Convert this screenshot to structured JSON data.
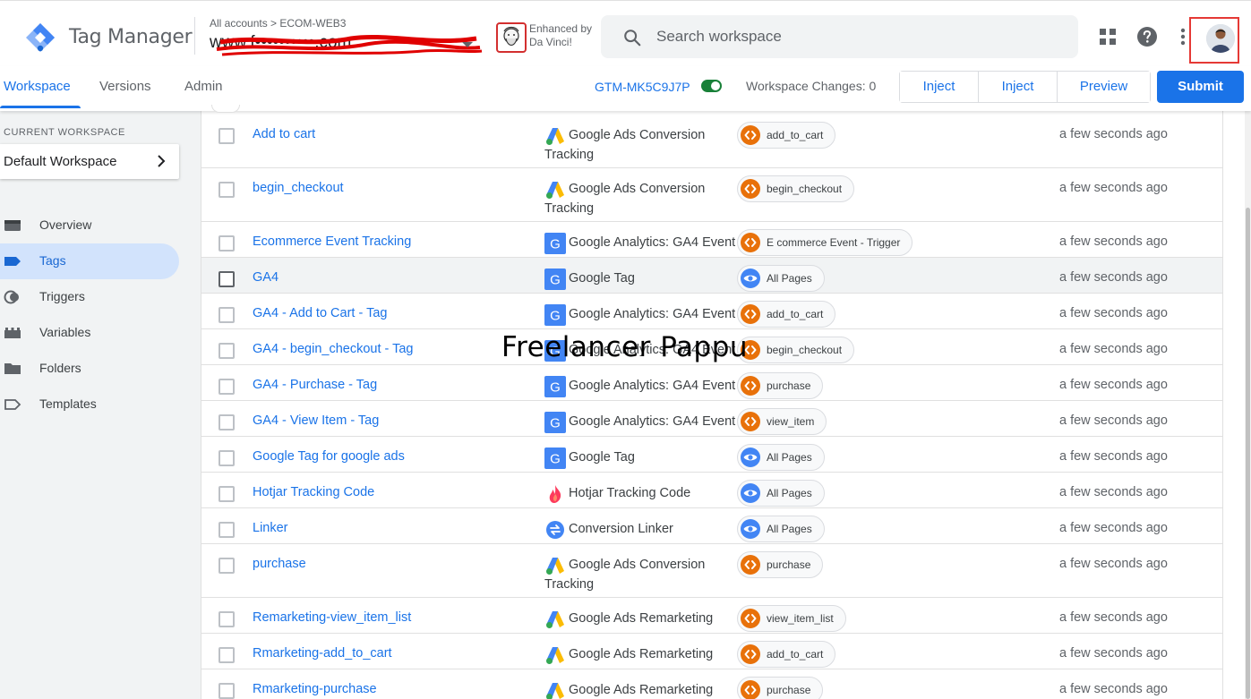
{
  "header": {
    "app_title": "Tag Manager",
    "breadcrumb": "All accounts > ECOM-WEB3",
    "container_name": "www.f••••••••••.com",
    "extension_text_line1": "Enhanced by",
    "extension_text_line2": "Da Vinci!",
    "search_placeholder": "Search workspace"
  },
  "nav": {
    "tabs": [
      {
        "label": "Workspace",
        "active": true
      },
      {
        "label": "Versions",
        "active": false
      },
      {
        "label": "Admin",
        "active": false
      }
    ],
    "container_id": "GTM-MK5C9J7P",
    "workspace_changes": "Workspace Changes: 0",
    "inject1_label": "Inject",
    "inject2_label": "Inject",
    "preview_label": "Preview",
    "submit_label": "Submit"
  },
  "sidebar": {
    "current_workspace_label": "CURRENT WORKSPACE",
    "workspace_name": "Default Workspace",
    "items": [
      {
        "label": "Overview",
        "icon": "overview-icon",
        "active": false
      },
      {
        "label": "Tags",
        "icon": "tag-icon",
        "active": true
      },
      {
        "label": "Triggers",
        "icon": "trigger-icon",
        "active": false
      },
      {
        "label": "Variables",
        "icon": "variables-icon",
        "active": false
      },
      {
        "label": "Folders",
        "icon": "folder-icon",
        "active": false
      },
      {
        "label": "Templates",
        "icon": "template-icon",
        "active": false
      }
    ]
  },
  "tags": [
    {
      "name": "Add to cart",
      "type": "Google Ads Conversion Tracking",
      "type_icon": "google-ads",
      "trigger": "add_to_cart",
      "trigger_icon": "custom-event",
      "modified": "a few seconds ago"
    },
    {
      "name": "begin_checkout",
      "type": "Google Ads Conversion Tracking",
      "type_icon": "google-ads",
      "trigger": "begin_checkout",
      "trigger_icon": "custom-event",
      "modified": "a few seconds ago"
    },
    {
      "name": "Ecommerce Event Tracking",
      "type": "Google Analytics: GA4 Event",
      "type_icon": "google-g",
      "trigger": "E commerce Event - Trigger",
      "trigger_icon": "custom-event",
      "modified": "a few seconds ago"
    },
    {
      "name": "GA4",
      "type": "Google Tag",
      "type_icon": "google-g",
      "trigger": "All Pages",
      "trigger_icon": "page-view",
      "modified": "a few seconds ago"
    },
    {
      "name": "GA4 - Add to Cart - Tag",
      "type": "Google Analytics: GA4 Event",
      "type_icon": "google-g",
      "trigger": "add_to_cart",
      "trigger_icon": "custom-event",
      "modified": "a few seconds ago"
    },
    {
      "name": "GA4 - begin_checkout - Tag",
      "type": "Google Analytics: GA4 Event",
      "type_icon": "google-g",
      "trigger": "begin_checkout",
      "trigger_icon": "custom-event",
      "modified": "a few seconds ago"
    },
    {
      "name": "GA4 - Purchase - Tag",
      "type": "Google Analytics: GA4 Event",
      "type_icon": "google-g",
      "trigger": "purchase",
      "trigger_icon": "custom-event",
      "modified": "a few seconds ago"
    },
    {
      "name": "GA4 - View Item - Tag",
      "type": "Google Analytics: GA4 Event",
      "type_icon": "google-g",
      "trigger": "view_item",
      "trigger_icon": "custom-event",
      "modified": "a few seconds ago"
    },
    {
      "name": "Google Tag for google ads",
      "type": "Google Tag",
      "type_icon": "google-g",
      "trigger": "All Pages",
      "trigger_icon": "page-view",
      "modified": "a few seconds ago"
    },
    {
      "name": "Hotjar Tracking Code",
      "type": "Hotjar Tracking Code",
      "type_icon": "hotjar",
      "trigger": "All Pages",
      "trigger_icon": "page-view",
      "modified": "a few seconds ago"
    },
    {
      "name": "Linker",
      "type": "Conversion Linker",
      "type_icon": "linker",
      "trigger": "All Pages",
      "trigger_icon": "page-view",
      "modified": "a few seconds ago"
    },
    {
      "name": "purchase",
      "type": "Google Ads Conversion Tracking",
      "type_icon": "google-ads",
      "trigger": "purchase",
      "trigger_icon": "custom-event",
      "modified": "a few seconds ago"
    },
    {
      "name": "Remarketing-view_item_list",
      "type": "Google Ads Remarketing",
      "type_icon": "google-ads",
      "trigger": "view_item_list",
      "trigger_icon": "custom-event",
      "modified": "a few seconds ago"
    },
    {
      "name": "Rmarketing-add_to_cart",
      "type": "Google Ads Remarketing",
      "type_icon": "google-ads",
      "trigger": "add_to_cart",
      "trigger_icon": "custom-event",
      "modified": "a few seconds ago"
    },
    {
      "name": "Rmarketing-purchase",
      "type": "Google Ads Remarketing",
      "type_icon": "google-ads",
      "trigger": "purchase",
      "trigger_icon": "custom-event",
      "modified": "a few seconds ago"
    }
  ],
  "overlay": {
    "watermark": "Freelancer Pappu"
  },
  "colors": {
    "accent": "#1a73e8",
    "active_nav_bg": "#d2e3fc",
    "custom_event_chip": "#e8710a",
    "page_view_chip": "#4285f4",
    "toggle_on": "#188038",
    "highlight_box": "#e53935"
  }
}
